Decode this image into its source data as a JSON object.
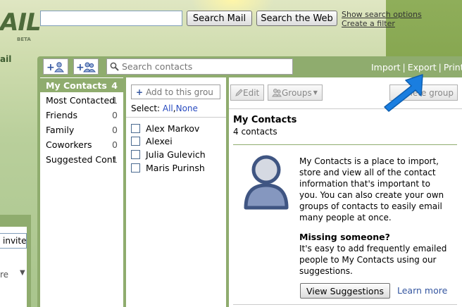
{
  "header": {
    "logo_text": "AIL",
    "beta": "BETA",
    "side_fragment": "ail",
    "search_mail_label": "Search Mail",
    "search_web_label": "Search the Web",
    "show_options_link": "Show search options",
    "create_filter_link": "Create a filter"
  },
  "contacts_toolbar": {
    "search_placeholder": "Search contacts",
    "import_label": "Import",
    "export_label": "Export",
    "print_label": "Print"
  },
  "groups": [
    {
      "name": "My Contacts",
      "count": "4"
    },
    {
      "name": "Most Contacted",
      "count": "1"
    },
    {
      "name": "Friends",
      "count": "0"
    },
    {
      "name": "Family",
      "count": "0"
    },
    {
      "name": "Coworkers",
      "count": "0"
    },
    {
      "name": "Suggested Cont",
      "count": "1"
    }
  ],
  "list_panel": {
    "add_to_group_label": "Add to this grou",
    "select_label": "Select:",
    "all_label": "All",
    "none_label": "None",
    "contacts": [
      "Alex Markov",
      "Alexei",
      "Julia Gulevich",
      "Maris Purinsh"
    ]
  },
  "detail": {
    "edit_label": "Edit",
    "groups_label": "Groups",
    "delete_group_label": "lete group",
    "title": "My Contacts",
    "count_text": "4 contacts",
    "description": "My Contacts is a place to import, store and view all of the contact information that's important to you. You can also create your own groups of contacts to easily email many people at once.",
    "missing_title": "Missing someone?",
    "missing_description": "It's easy to add frequently emailed people to My Contacts using our suggestions.",
    "view_suggestions_label": "View Suggestions",
    "learn_more_label": "Learn more"
  },
  "left_fragment": {
    "invite_label": "invite",
    "re_label": "re"
  },
  "colors": {
    "accent_green": "#8fac6e",
    "link_blue": "#3456a0",
    "arrow_blue": "#1a7ee0"
  }
}
